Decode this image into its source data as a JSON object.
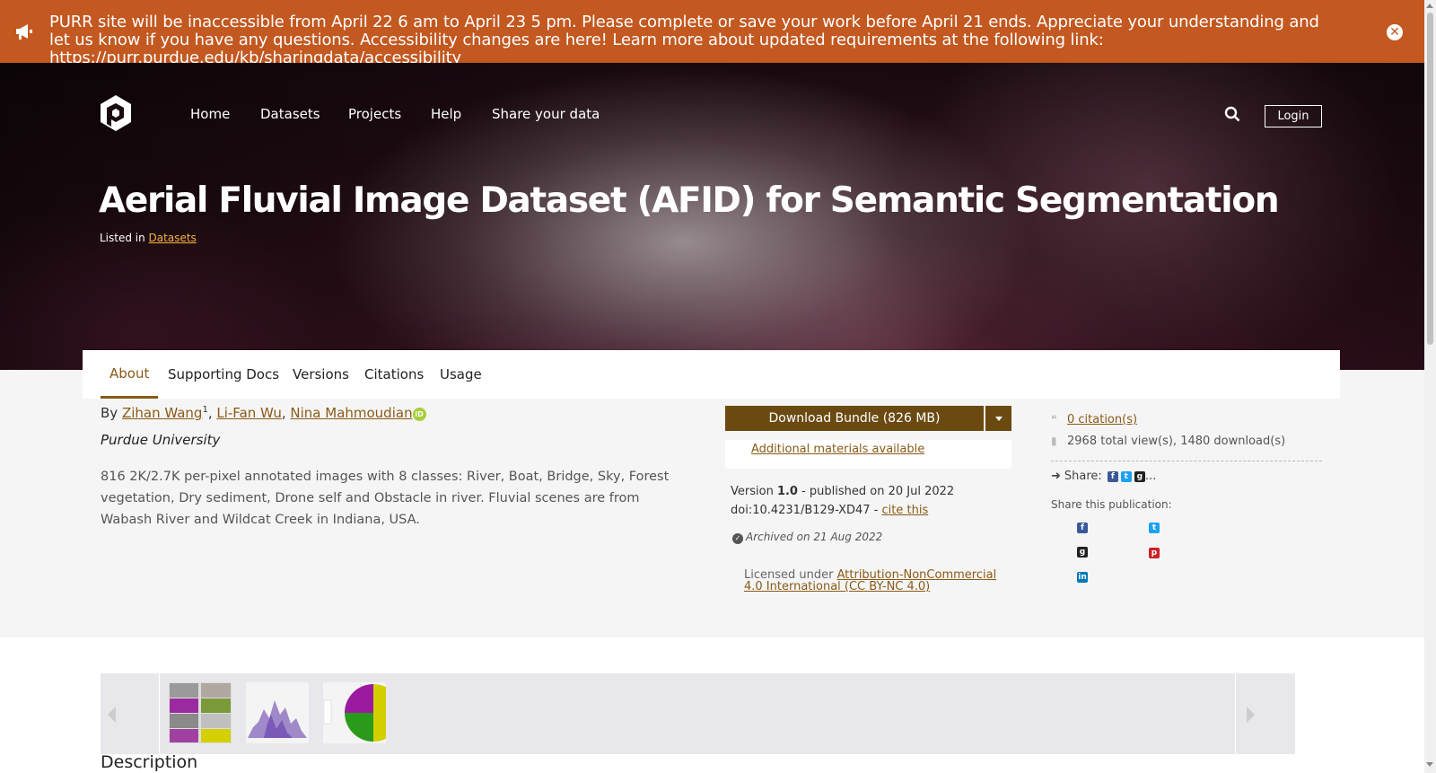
{
  "alert": {
    "message": "PURR site will be inaccessible from April 22 6 am to April 23 5 pm. Please complete or save your work before April 21 ends. Appreciate your understanding and let us know if you have any questions. Accessibility changes are here! Learn more about updated requirements at the following link: ",
    "link": "https://purr.purdue.edu/kb/sharingdata/accessibility",
    "icon": "megaphone-icon",
    "close_icon": "close-icon"
  },
  "nav": {
    "items": [
      "Home",
      "Datasets",
      "Projects",
      "Help",
      "Share your data"
    ],
    "login": "Login",
    "search_icon": "search-icon"
  },
  "page": {
    "title": "Aerial Fluvial Image Dataset (AFID) for Semantic Segmentation",
    "listed_prefix": "Listed in ",
    "listed_link": "Datasets"
  },
  "tabs": [
    "About",
    "Supporting Docs",
    "Versions",
    "Citations",
    "Usage"
  ],
  "main": {
    "by": "By ",
    "authors": [
      {
        "name": "Zihan Wang",
        "sup": "1"
      },
      {
        "name": "Li-Fan Wu",
        "sup": ""
      },
      {
        "name": "Nina Mahmoudian",
        "sup": ""
      }
    ],
    "sep": ", ",
    "orcid_label": "iD",
    "organization": "Purdue University",
    "abstract": "816 2K/2.7K per-pixel annotated images with 8 classes: River, Boat, Bridge, Sky, Forest vegetation, Dry sediment, Drone self and Obstacle in river. Fluvial scenes are from Wabash River and Wildcat Creek in Indiana, USA."
  },
  "download": {
    "button": "Download Bundle (826 MB)",
    "additional": "Additional materials available",
    "version_prefix": "Version ",
    "version": "1.0",
    "published": " - published on 20 Jul 2022",
    "doi": "doi:10.4231/B129-XD47 - ",
    "cite": "cite this",
    "archived": "Archived on 21 Aug 2022",
    "license_prefix": "Licensed under ",
    "license_link": "Attribution-NonCommercial 4.0 International (CC BY-NC 4.0)"
  },
  "stats": {
    "citations": "0 citation(s)",
    "views": "2968 total view(s), 1480 download(s)",
    "share": "Share:",
    "share_more": "...",
    "share_publication": "Share this publication:"
  },
  "lower": {
    "description_heading": "Description"
  },
  "colors": {
    "alert": "#c35820",
    "accent": "#8a5a17",
    "download": "#6b4a12"
  }
}
